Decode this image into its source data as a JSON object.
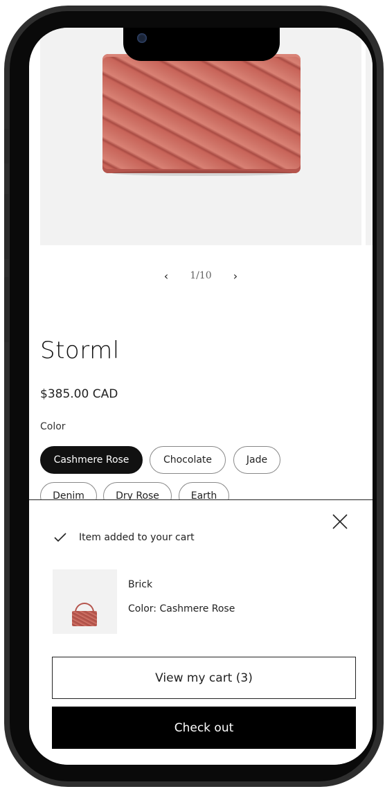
{
  "product": {
    "title": "Storml",
    "price": "$385.00 CAD",
    "image_pager": {
      "current": "1/10",
      "prev_icon": "chevron-left-icon",
      "next_icon": "chevron-right-icon"
    },
    "color_label": "Color",
    "color_options": [
      "Cashmere Rose",
      "Chocolate",
      "Jade",
      "Denim",
      "Dry Rose",
      "Earth"
    ],
    "selected_color": "Cashmere Rose"
  },
  "cart_drawer": {
    "status_text": "Item added to your cart",
    "item": {
      "name": "Brick",
      "color": "Color: Cashmere Rose"
    },
    "view_cart_label": "View my cart (3)",
    "checkout_label": "Check out"
  },
  "colors": {
    "bag": "#cf7468",
    "selected_chip": "#111111",
    "image_bg": "#f2f2f2"
  }
}
